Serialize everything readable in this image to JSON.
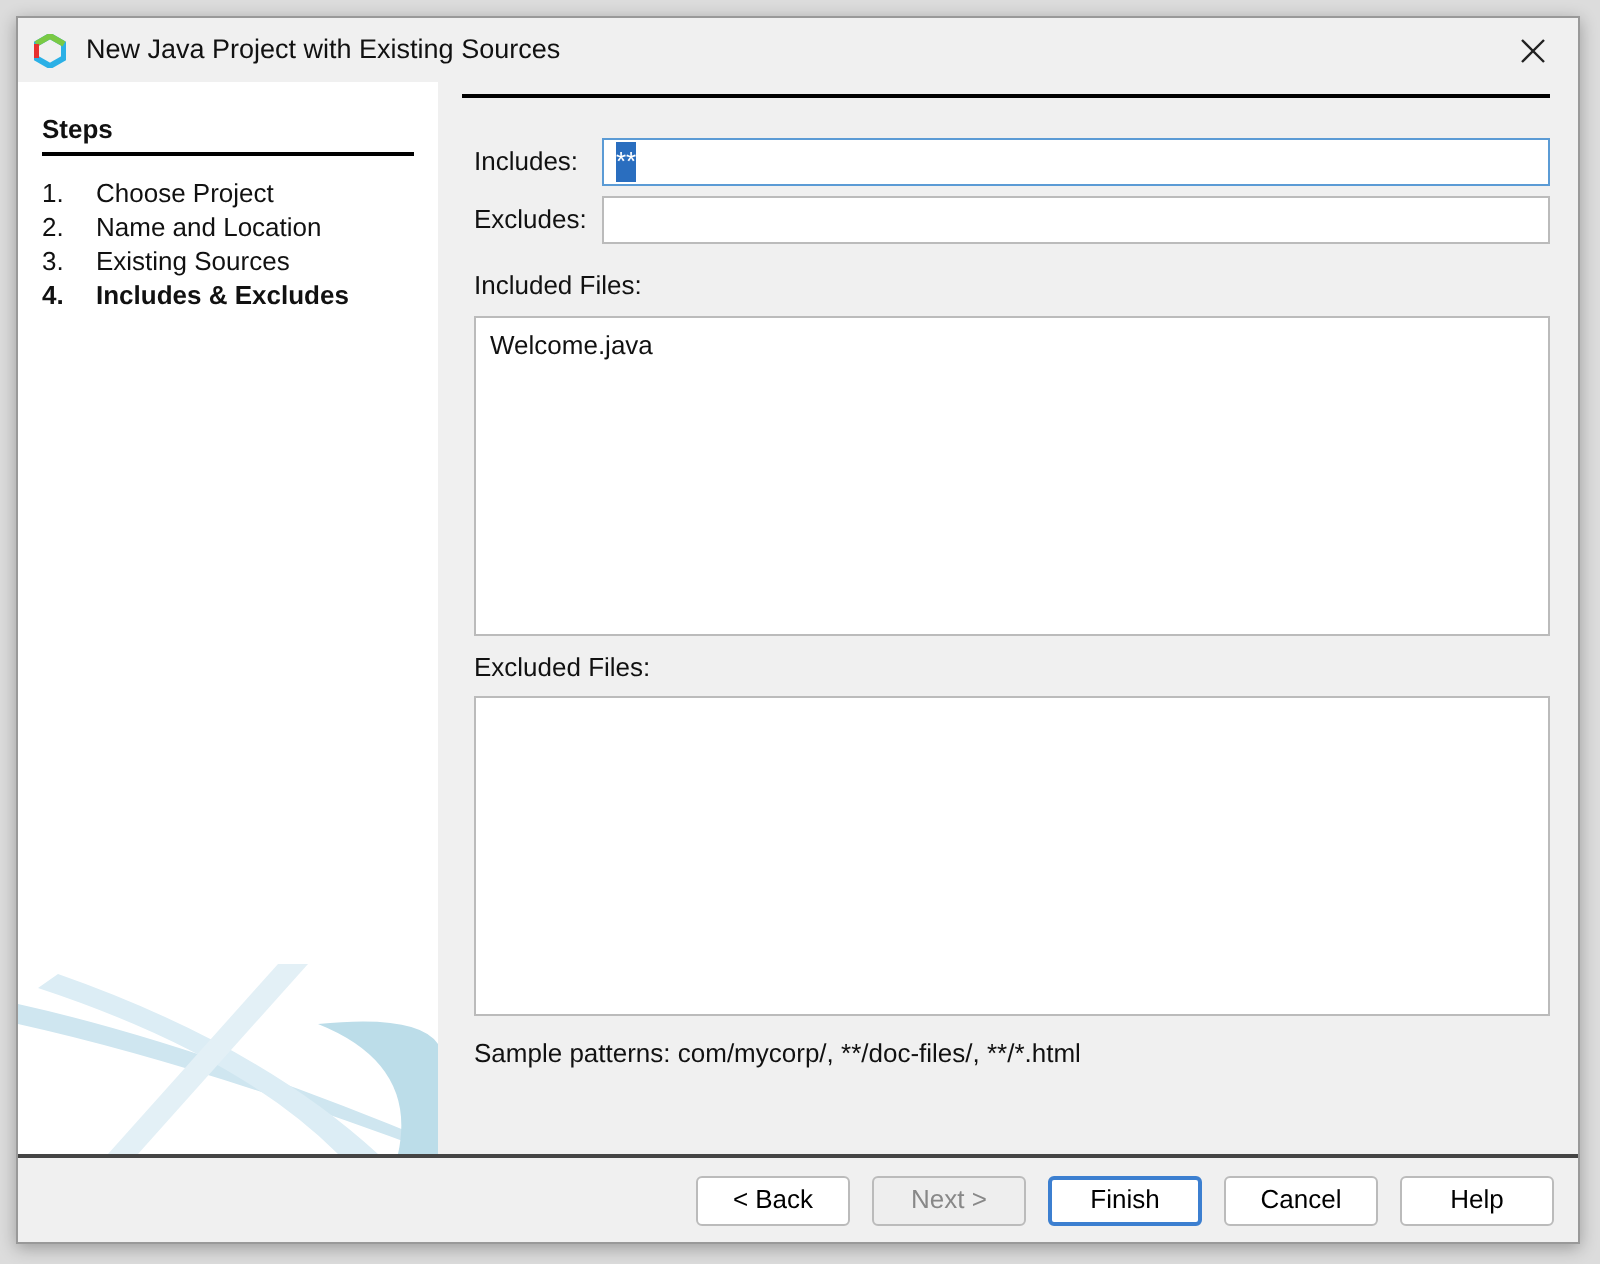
{
  "window": {
    "title": "New Java Project with Existing Sources"
  },
  "steps": {
    "title": "Steps",
    "items": [
      {
        "number": "1.",
        "label": "Choose Project",
        "selected": false
      },
      {
        "number": "2.",
        "label": "Name and Location",
        "selected": false
      },
      {
        "number": "3.",
        "label": "Existing Sources",
        "selected": false
      },
      {
        "number": "4.",
        "label": "Includes & Excludes",
        "selected": true
      }
    ]
  },
  "fields": [
    {
      "label": "Includes:",
      "value": "**",
      "focused": true,
      "value_selected": true
    },
    {
      "label": "Excludes:",
      "focused": false
    }
  ],
  "lists": [
    {
      "label": "Included Files:",
      "items": [
        "Welcome.java"
      ]
    },
    {
      "label": "Excluded Files:"
    }
  ],
  "hint": "Sample patterns: com/mycorp/, **/doc-files/, **/*.html",
  "buttons": [
    {
      "label": "< Back",
      "disabled": false,
      "default": false
    },
    {
      "label": "Next >",
      "disabled": true,
      "default": false
    },
    {
      "label": "Finish",
      "disabled": false,
      "default": true
    },
    {
      "label": "Cancel",
      "disabled": false,
      "default": false
    },
    {
      "label": "Help",
      "disabled": false,
      "default": false
    }
  ]
}
